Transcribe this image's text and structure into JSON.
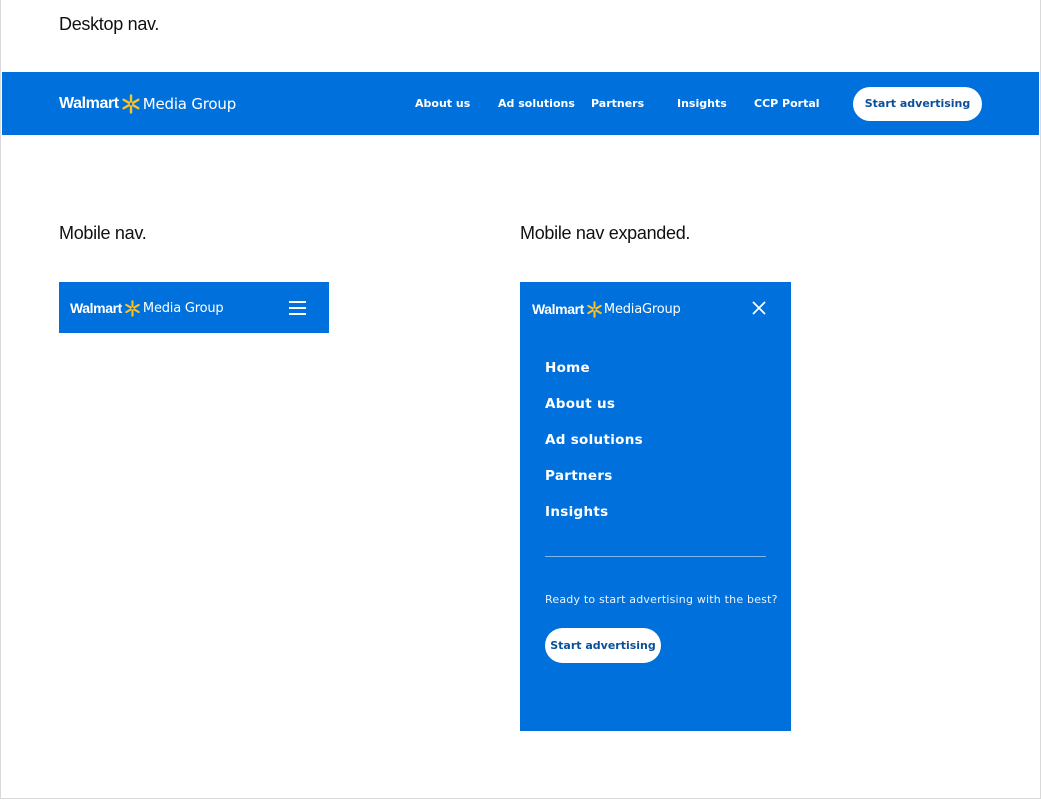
{
  "labels": {
    "desktop": "Desktop nav.",
    "mobile": "Mobile nav.",
    "mobile_expanded": "Mobile nav expanded."
  },
  "brand": {
    "walmart": "Walmart",
    "media_group": "Media Group",
    "media_group_compact": "MediaGroup",
    "spark_icon": "walmart-spark-icon"
  },
  "colors": {
    "brand_blue": "#0071dc",
    "spark_yellow": "#ffc220",
    "button_text": "#0a4f99",
    "white": "#ffffff"
  },
  "desktop_nav": {
    "links": [
      "About us",
      "Ad solutions",
      "Partners",
      "Insights",
      "CCP Portal"
    ],
    "cta": "Start advertising"
  },
  "mobile_nav": {
    "menu_icon": "hamburger-menu-icon"
  },
  "mobile_expanded": {
    "close_icon": "close-icon",
    "menu_items": [
      "Home",
      "About us",
      "Ad solutions",
      "Partners",
      "Insights"
    ],
    "cta_prompt": "Ready to start advertising with the best?",
    "cta": "Start advertising"
  }
}
